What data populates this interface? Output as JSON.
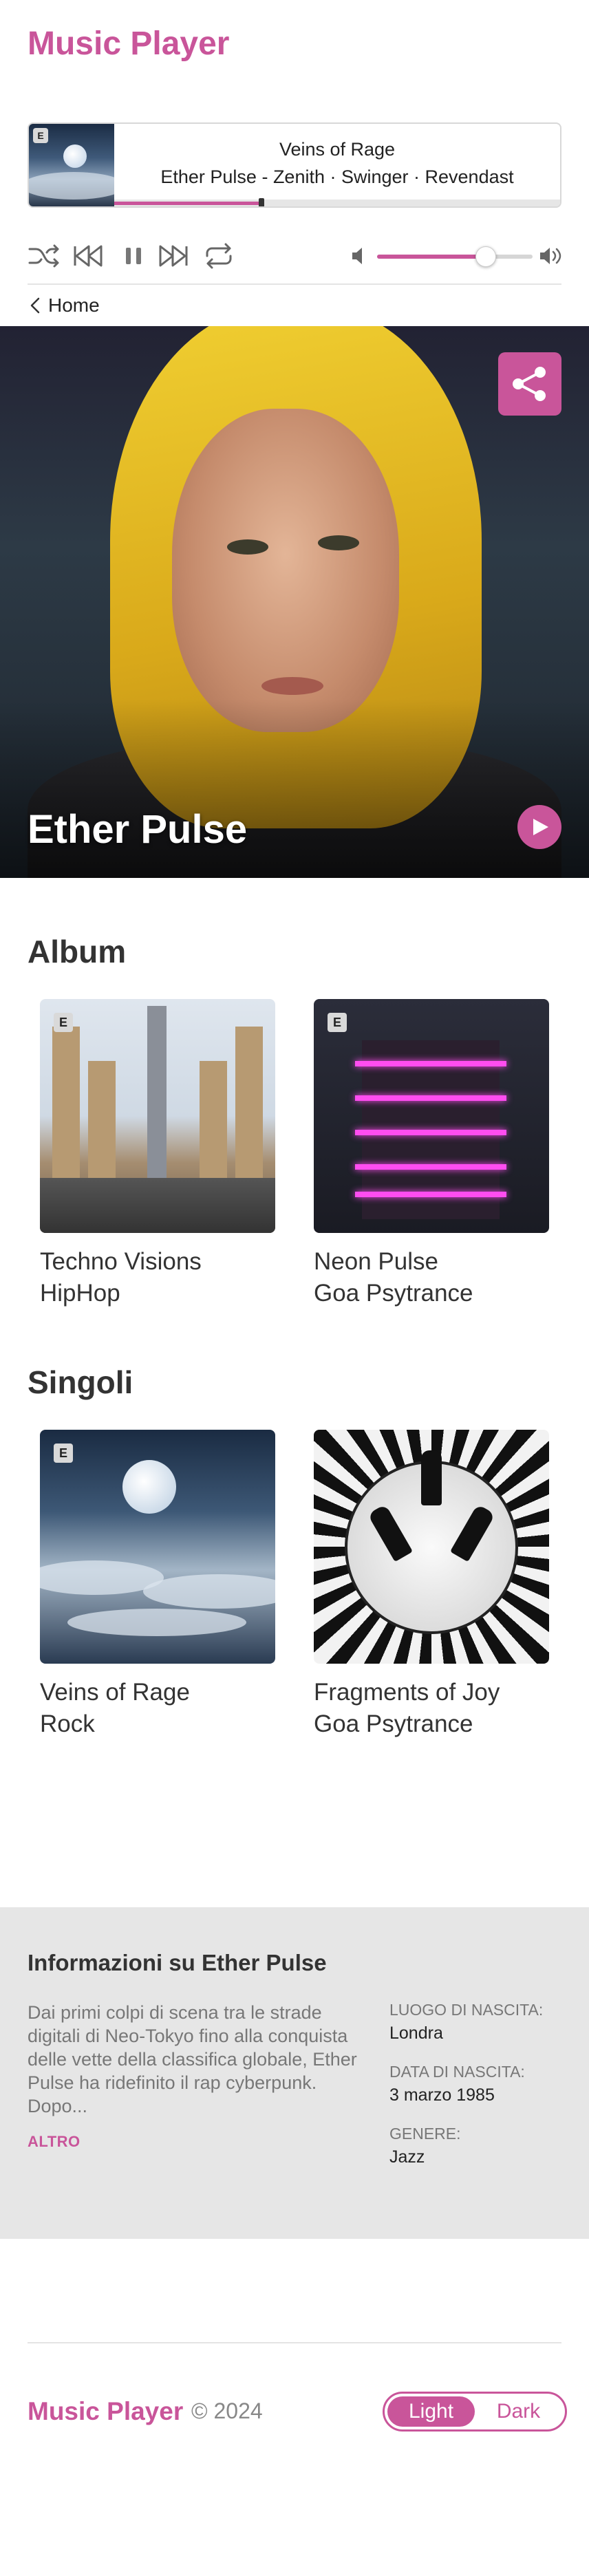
{
  "app": {
    "title": "Music Player"
  },
  "now_playing": {
    "explicit_badge": "E",
    "title": "Veins of Rage",
    "subtitle": "Ether Pulse - Zenith · Swinger · Revendast",
    "progress": 0.33
  },
  "controls": {
    "shuffle_icon": "shuffle-icon",
    "prev_icon": "skip-back-icon",
    "pause_icon": "pause-icon",
    "next_icon": "skip-forward-icon",
    "repeat_icon": "repeat-icon",
    "volume_low_icon": "volume-low-icon",
    "volume_high_icon": "volume-high-icon",
    "volume": 0.7
  },
  "breadcrumb": {
    "label": "Home"
  },
  "artist": {
    "name": "Ether Pulse",
    "share_icon": "share-icon",
    "play_icon": "play-icon"
  },
  "albums": {
    "heading": "Album",
    "items": [
      {
        "title": "Techno Visions",
        "genre": "HipHop",
        "explicit": "E"
      },
      {
        "title": "Neon Pulse",
        "genre": "Goa Psytrance",
        "explicit": "E"
      }
    ]
  },
  "singles": {
    "heading": "Singoli",
    "items": [
      {
        "title": "Veins of Rage",
        "genre": "Rock",
        "explicit": "E"
      },
      {
        "title": "Fragments of Joy",
        "genre": "Goa Psytrance"
      }
    ]
  },
  "info": {
    "title": "Informazioni su Ether Pulse",
    "bio": "Dai primi colpi di scena tra le strade digitali di Neo-Tokyo fino alla conquista delle vette della classifica globale, Ether Pulse ha ridefinito il rap cyberpunk. Dopo...",
    "more": "ALTRO",
    "facts": [
      {
        "label": "LUOGO DI NASCITA:",
        "value": "Londra"
      },
      {
        "label": "DATA DI NASCITA:",
        "value": "3 marzo 1985"
      },
      {
        "label": "GENERE:",
        "value": "Jazz"
      }
    ]
  },
  "footer": {
    "brand": "Music Player",
    "copyright": "© 2024",
    "theme_light": "Light",
    "theme_dark": "Dark",
    "active_theme": "Light"
  },
  "colors": {
    "accent": "#c9559a",
    "panel": "#e6e6e6"
  }
}
